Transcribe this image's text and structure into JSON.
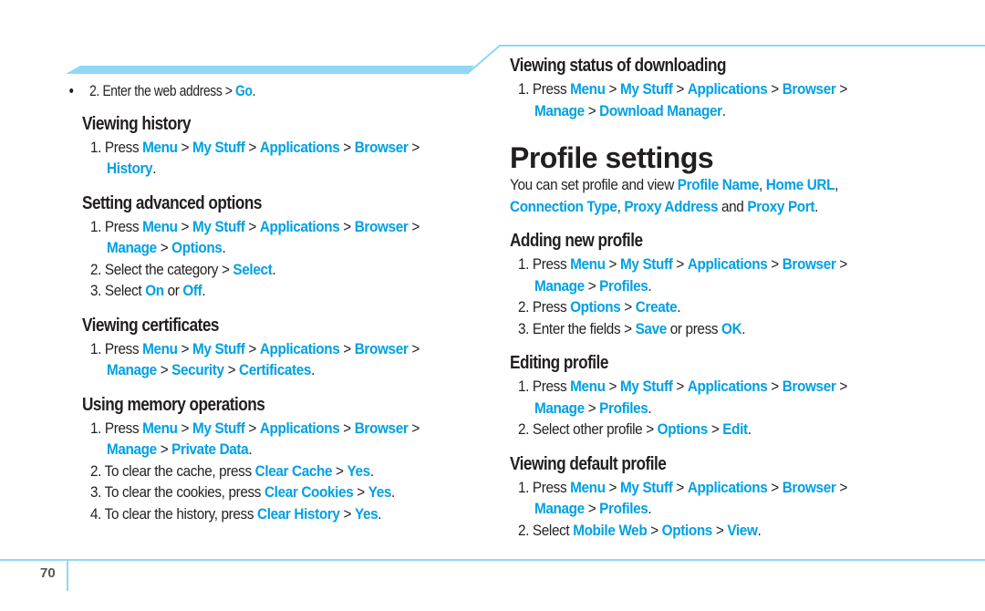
{
  "page_number": "70",
  "accent_color": "#00a0e3",
  "band_color": "#8fd8f6",
  "left_column": {
    "continuation_step": {
      "num": "2.",
      "parts": [
        {
          "t": "Enter the web address > "
        },
        {
          "t": "Go",
          "hl": true
        },
        {
          "t": "."
        }
      ]
    },
    "sections": [
      {
        "title": "Viewing history",
        "steps": [
          {
            "num": "1.",
            "parts": [
              {
                "t": "Press "
              },
              {
                "t": "Menu",
                "hl": true
              },
              {
                "t": " > "
              },
              {
                "t": "My Stuff",
                "hl": true
              },
              {
                "t": " > "
              },
              {
                "t": "Applications",
                "hl": true
              },
              {
                "t": " > "
              },
              {
                "t": "Browser",
                "hl": true
              },
              {
                "t": " > "
              },
              {
                "t": "History",
                "hl": true
              },
              {
                "t": "."
              }
            ]
          }
        ]
      },
      {
        "title": "Setting advanced options",
        "steps": [
          {
            "num": "1.",
            "parts": [
              {
                "t": "Press "
              },
              {
                "t": "Menu",
                "hl": true
              },
              {
                "t": " > "
              },
              {
                "t": "My Stuff",
                "hl": true
              },
              {
                "t": " > "
              },
              {
                "t": "Applications",
                "hl": true
              },
              {
                "t": " > "
              },
              {
                "t": "Browser",
                "hl": true
              },
              {
                "t": " > "
              },
              {
                "t": "Manage",
                "hl": true
              },
              {
                "t": " > "
              },
              {
                "t": "Options",
                "hl": true
              },
              {
                "t": "."
              }
            ]
          },
          {
            "num": "2.",
            "parts": [
              {
                "t": "Select the category > "
              },
              {
                "t": "Select",
                "hl": true
              },
              {
                "t": "."
              }
            ]
          },
          {
            "num": "3.",
            "parts": [
              {
                "t": "Select "
              },
              {
                "t": "On",
                "hl": true
              },
              {
                "t": " or "
              },
              {
                "t": "Off",
                "hl": true
              },
              {
                "t": "."
              }
            ]
          }
        ]
      },
      {
        "title": "Viewing certificates",
        "steps": [
          {
            "num": "1.",
            "parts": [
              {
                "t": "Press "
              },
              {
                "t": "Menu",
                "hl": true
              },
              {
                "t": " > "
              },
              {
                "t": "My Stuff",
                "hl": true
              },
              {
                "t": " > "
              },
              {
                "t": "Applications",
                "hl": true
              },
              {
                "t": " > "
              },
              {
                "t": "Browser",
                "hl": true
              },
              {
                "t": " > "
              },
              {
                "t": "Manage",
                "hl": true
              },
              {
                "t": " > "
              },
              {
                "t": "Security",
                "hl": true
              },
              {
                "t": " > "
              },
              {
                "t": "Certificates",
                "hl": true
              },
              {
                "t": "."
              }
            ]
          }
        ]
      },
      {
        "title": "Using memory operations",
        "steps": [
          {
            "num": "1.",
            "parts": [
              {
                "t": "Press "
              },
              {
                "t": "Menu",
                "hl": true
              },
              {
                "t": " > "
              },
              {
                "t": "My Stuff",
                "hl": true
              },
              {
                "t": " > "
              },
              {
                "t": "Applications",
                "hl": true
              },
              {
                "t": " > "
              },
              {
                "t": "Browser",
                "hl": true
              },
              {
                "t": " > "
              },
              {
                "t": "Manage",
                "hl": true
              },
              {
                "t": " > "
              },
              {
                "t": "Private Data",
                "hl": true
              },
              {
                "t": "."
              }
            ]
          },
          {
            "num": "2.",
            "parts": [
              {
                "t": "To clear the cache, press "
              },
              {
                "t": "Clear Cache",
                "hl": true
              },
              {
                "t": " > "
              },
              {
                "t": "Yes",
                "hl": true
              },
              {
                "t": "."
              }
            ]
          },
          {
            "num": "3.",
            "parts": [
              {
                "t": "To clear the cookies, press "
              },
              {
                "t": "Clear Cookies",
                "hl": true
              },
              {
                "t": " > "
              },
              {
                "t": "Yes",
                "hl": true
              },
              {
                "t": "."
              }
            ]
          },
          {
            "num": "4.",
            "parts": [
              {
                "t": "To clear the history, press "
              },
              {
                "t": "Clear History",
                "hl": true
              },
              {
                "t": " > "
              },
              {
                "t": "Yes",
                "hl": true
              },
              {
                "t": "."
              }
            ]
          }
        ]
      }
    ]
  },
  "right_column": {
    "top_section": {
      "title": "Viewing status of downloading",
      "steps": [
        {
          "num": "1.",
          "parts": [
            {
              "t": "Press "
            },
            {
              "t": "Menu",
              "hl": true
            },
            {
              "t": " > "
            },
            {
              "t": "My Stuff",
              "hl": true
            },
            {
              "t": " > "
            },
            {
              "t": "Applications",
              "hl": true
            },
            {
              "t": " > "
            },
            {
              "t": "Browser",
              "hl": true
            },
            {
              "t": " > "
            },
            {
              "t": "Manage",
              "hl": true
            },
            {
              "t": " > "
            },
            {
              "t": "Download Manager",
              "hl": true
            },
            {
              "t": "."
            }
          ]
        }
      ]
    },
    "chapter_title": "Profile settings",
    "intro": [
      {
        "t": "You can set profile and view "
      },
      {
        "t": "Profile Name",
        "hl": true
      },
      {
        "t": ", "
      },
      {
        "t": "Home URL",
        "hl": true
      },
      {
        "t": ", "
      },
      {
        "t": "Connection Type",
        "hl": true
      },
      {
        "t": ", "
      },
      {
        "t": "Proxy Address",
        "hl": true
      },
      {
        "t": " and "
      },
      {
        "t": "Proxy Port",
        "hl": true
      },
      {
        "t": "."
      }
    ],
    "sections": [
      {
        "title": "Adding new profile",
        "steps": [
          {
            "num": "1.",
            "parts": [
              {
                "t": "Press "
              },
              {
                "t": "Menu",
                "hl": true
              },
              {
                "t": " > "
              },
              {
                "t": "My Stuff",
                "hl": true
              },
              {
                "t": " > "
              },
              {
                "t": "Applications",
                "hl": true
              },
              {
                "t": " > "
              },
              {
                "t": "Browser",
                "hl": true
              },
              {
                "t": " > "
              },
              {
                "t": "Manage",
                "hl": true
              },
              {
                "t": " > "
              },
              {
                "t": "Profiles",
                "hl": true
              },
              {
                "t": "."
              }
            ]
          },
          {
            "num": "2.",
            "parts": [
              {
                "t": "Press "
              },
              {
                "t": "Options",
                "hl": true
              },
              {
                "t": " > "
              },
              {
                "t": "Create",
                "hl": true
              },
              {
                "t": "."
              }
            ]
          },
          {
            "num": "3.",
            "parts": [
              {
                "t": "Enter the fields > "
              },
              {
                "t": "Save",
                "hl": true
              },
              {
                "t": " or press "
              },
              {
                "t": "OK",
                "hl": true
              },
              {
                "t": "."
              }
            ]
          }
        ]
      },
      {
        "title": "Editing profile",
        "steps": [
          {
            "num": "1.",
            "parts": [
              {
                "t": "Press "
              },
              {
                "t": "Menu",
                "hl": true
              },
              {
                "t": " > "
              },
              {
                "t": "My Stuff",
                "hl": true
              },
              {
                "t": " > "
              },
              {
                "t": "Applications",
                "hl": true
              },
              {
                "t": " > "
              },
              {
                "t": "Browser",
                "hl": true
              },
              {
                "t": " > "
              },
              {
                "t": "Manage",
                "hl": true
              },
              {
                "t": " > "
              },
              {
                "t": "Profiles",
                "hl": true
              },
              {
                "t": "."
              }
            ]
          },
          {
            "num": "2.",
            "parts": [
              {
                "t": "Select other profile > "
              },
              {
                "t": "Options",
                "hl": true
              },
              {
                "t": " > "
              },
              {
                "t": "Edit",
                "hl": true
              },
              {
                "t": "."
              }
            ]
          }
        ]
      },
      {
        "title": "Viewing default profile",
        "steps": [
          {
            "num": "1.",
            "parts": [
              {
                "t": "Press "
              },
              {
                "t": "Menu",
                "hl": true
              },
              {
                "t": " > "
              },
              {
                "t": "My Stuff",
                "hl": true
              },
              {
                "t": " > "
              },
              {
                "t": "Applications",
                "hl": true
              },
              {
                "t": " > "
              },
              {
                "t": "Browser",
                "hl": true
              },
              {
                "t": " > "
              },
              {
                "t": "Manage",
                "hl": true
              },
              {
                "t": " > "
              },
              {
                "t": "Profiles",
                "hl": true
              },
              {
                "t": "."
              }
            ]
          },
          {
            "num": "2.",
            "parts": [
              {
                "t": "Select "
              },
              {
                "t": "Mobile Web",
                "hl": true
              },
              {
                "t": " > "
              },
              {
                "t": "Options",
                "hl": true
              },
              {
                "t": " > "
              },
              {
                "t": "View",
                "hl": true
              },
              {
                "t": "."
              }
            ]
          }
        ]
      }
    ]
  }
}
